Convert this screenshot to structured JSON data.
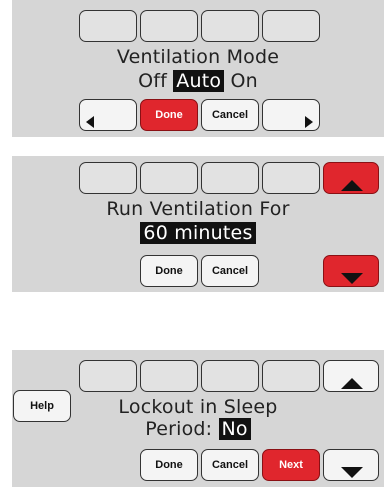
{
  "screen1": {
    "line1": "Ventilation Mode",
    "options": [
      "Off",
      "Auto",
      "On"
    ],
    "selected_option": "Auto",
    "buttons": {
      "done": "Done",
      "cancel": "Cancel"
    }
  },
  "screen2": {
    "line1": "Run Ventilation For",
    "value": "60 minutes",
    "buttons": {
      "done": "Done",
      "cancel": "Cancel"
    }
  },
  "screen3": {
    "line1": "Lockout in Sleep",
    "line2_label": "Period:",
    "value": "No",
    "buttons": {
      "help": "Help",
      "done": "Done",
      "cancel": "Cancel",
      "next": "Next"
    }
  },
  "colors": {
    "accent_red": "#e0262d",
    "panel": "#d6d6d6",
    "lcd_highlight": "#111111"
  },
  "icons": [
    "left-arrow-icon",
    "right-arrow-icon",
    "up-arrow-icon",
    "down-arrow-icon"
  ]
}
